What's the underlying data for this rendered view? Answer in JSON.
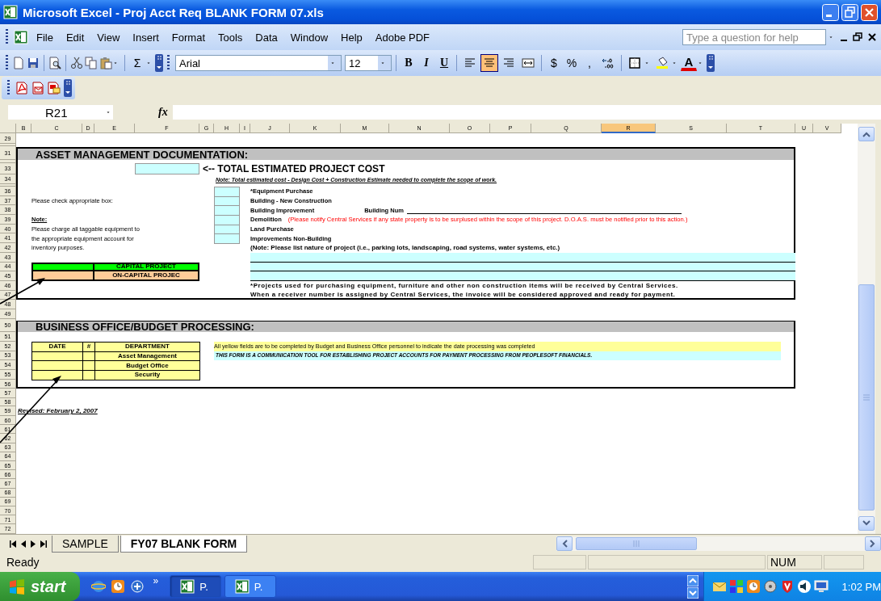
{
  "window": {
    "title": "Microsoft Excel - Proj Acct Req BLANK FORM 07.xls"
  },
  "menu": [
    "File",
    "Edit",
    "View",
    "Insert",
    "Format",
    "Tools",
    "Data",
    "Window",
    "Help",
    "Adobe PDF"
  ],
  "help_box": {
    "placeholder": "Type a question for help"
  },
  "standard_toolbar": [
    {
      "kind": "new"
    },
    {
      "kind": "save"
    },
    {
      "kind": "separator"
    },
    {
      "kind": "preview"
    },
    {
      "kind": "separator"
    },
    {
      "kind": "cut"
    },
    {
      "kind": "copy"
    },
    {
      "kind": "paste"
    },
    {
      "kind": "dropdown"
    },
    {
      "kind": "separator"
    },
    {
      "kind": "text",
      "label": "Σ"
    },
    {
      "kind": "dropdown"
    },
    {
      "kind": "overflow"
    }
  ],
  "formatting_toolbar": {
    "font": "Arial",
    "size": "12",
    "buttons": [
      {
        "kind": "bold",
        "label": "B",
        "on": false
      },
      {
        "kind": "italic",
        "label": "I",
        "on": false
      },
      {
        "kind": "underline",
        "label": "U",
        "on": false
      },
      {
        "kind": "separator"
      },
      {
        "kind": "align-left",
        "on": false
      },
      {
        "kind": "align-center",
        "on": true
      },
      {
        "kind": "align-right",
        "on": false
      },
      {
        "kind": "merge",
        "on": false
      },
      {
        "kind": "separator"
      },
      {
        "kind": "text",
        "label": "$",
        "on": false
      },
      {
        "kind": "text",
        "label": "%",
        "on": false
      },
      {
        "kind": "text",
        "label": ",",
        "on": false
      },
      {
        "kind": "decimal",
        "on": false
      },
      {
        "kind": "separator"
      },
      {
        "kind": "borders",
        "on": false
      },
      {
        "kind": "dropdown"
      },
      {
        "kind": "fill",
        "on": false
      },
      {
        "kind": "dropdown"
      },
      {
        "kind": "font-color",
        "label": "A",
        "on": false
      },
      {
        "kind": "dropdown"
      },
      {
        "kind": "overflow"
      }
    ]
  },
  "pdf_toolbar": [
    {
      "kind": "pdf"
    },
    {
      "kind": "pdf-mail"
    },
    {
      "kind": "pdf-review"
    }
  ],
  "formula_bar": {
    "name_box": "R21",
    "function_label": "fx"
  },
  "columns": [
    {
      "label": "B",
      "selected": false
    },
    {
      "label": "C",
      "selected": false
    },
    {
      "label": "D",
      "selected": false
    },
    {
      "label": "E",
      "selected": false
    },
    {
      "label": "F",
      "selected": false
    },
    {
      "label": "G",
      "selected": false
    },
    {
      "label": "H",
      "selected": false
    },
    {
      "label": "I",
      "selected": false
    },
    {
      "label": "J",
      "selected": false
    },
    {
      "label": "K",
      "selected": false
    },
    {
      "label": "M",
      "selected": false
    },
    {
      "label": "N",
      "selected": false
    },
    {
      "label": "O",
      "selected": false
    },
    {
      "label": "P",
      "selected": false
    },
    {
      "label": "Q",
      "selected": false
    },
    {
      "label": "R",
      "selected": true
    },
    {
      "label": "S",
      "selected": false
    },
    {
      "label": "T",
      "selected": false
    },
    {
      "label": "U",
      "selected": false
    },
    {
      "label": "V",
      "selected": false
    }
  ],
  "rows": [
    {
      "kind": "row",
      "label": "29"
    },
    {
      "kind": "collapsed"
    },
    {
      "kind": "row",
      "label": "31"
    },
    {
      "kind": "collapsed"
    },
    {
      "kind": "row",
      "label": "33"
    },
    {
      "kind": "row",
      "label": "34"
    },
    {
      "kind": "collapsed"
    },
    {
      "kind": "row",
      "label": "36"
    },
    {
      "kind": "row",
      "label": "37"
    },
    {
      "kind": "row",
      "label": "38"
    },
    {
      "kind": "row",
      "label": "39"
    },
    {
      "kind": "row",
      "label": "40"
    },
    {
      "kind": "row",
      "label": "41"
    },
    {
      "kind": "row",
      "label": "42"
    },
    {
      "kind": "row",
      "label": "43"
    },
    {
      "kind": "row",
      "label": "44"
    },
    {
      "kind": "row",
      "label": "45"
    },
    {
      "kind": "row",
      "label": "46"
    },
    {
      "kind": "row",
      "label": "47"
    },
    {
      "kind": "row",
      "label": "48"
    },
    {
      "kind": "row",
      "label": "49"
    },
    {
      "kind": "row",
      "label": "50"
    },
    {
      "kind": "row",
      "label": "51"
    },
    {
      "kind": "row",
      "label": "52"
    },
    {
      "kind": "row",
      "label": "53"
    },
    {
      "kind": "row",
      "label": "54"
    },
    {
      "kind": "row",
      "label": "55"
    },
    {
      "kind": "row",
      "label": "56"
    },
    {
      "kind": "row",
      "label": "57"
    },
    {
      "kind": "row",
      "label": "58"
    },
    {
      "kind": "row",
      "label": "59"
    },
    {
      "kind": "row",
      "label": "60"
    },
    {
      "kind": "row",
      "label": "61"
    },
    {
      "kind": "row",
      "label": "62"
    },
    {
      "kind": "row",
      "label": "63"
    },
    {
      "kind": "row",
      "label": "64"
    },
    {
      "kind": "row",
      "label": "65"
    },
    {
      "kind": "row",
      "label": "66"
    },
    {
      "kind": "row",
      "label": "67"
    },
    {
      "kind": "row",
      "label": "68"
    },
    {
      "kind": "row",
      "label": "69"
    },
    {
      "kind": "row",
      "label": "70"
    },
    {
      "kind": "row",
      "label": "71"
    },
    {
      "kind": "row",
      "label": "72"
    }
  ],
  "asset_section": {
    "title": "ASSET MANAGEMENT DOCUMENTATION:",
    "total_label": "<-- TOTAL ESTIMATED PROJECT COST",
    "total_note": "Note: Total estimated cost - Design Cost + Construction Estimate needed to complete the scope of work.",
    "check_prompt": "Please check appropriate box:",
    "note_heading": "Note:",
    "note_lines": [
      "Please charge all taggable equipment to",
      "the appropriate equipment account for",
      "inventory purposes."
    ],
    "options": [
      {
        "label": "*Equipment Purchase",
        "checked": false
      },
      {
        "label": "Building - New Construction",
        "checked": false
      },
      {
        "label": "Building Improvement",
        "checked": false,
        "extra": {
          "kind": "number-line",
          "text": "Building Num"
        }
      },
      {
        "label": "Demolition",
        "checked": false,
        "extra": {
          "kind": "warning",
          "text": "(Please notify Central Services if any state property is to be surplused within the scope of this project.  D.O.A.S. must be notified prior to this action.)"
        }
      },
      {
        "label": "Land Purchase",
        "checked": false
      },
      {
        "label": "Improvements Non-Building",
        "checked": false
      }
    ],
    "list_note": "(Note:  Please list nature of project (i.e., parking lots, landscaping, road systems, water systems, etc.)",
    "project_types": [
      {
        "label": "CAPITAL PROJECT",
        "color": "#00ff00"
      },
      {
        "label": "ON-CAPITAL PROJEC",
        "color": "#ffcc99"
      }
    ],
    "footnotes": [
      "*Projects used for purchasing equipment, furniture and other non construction items will be received by Central Services.",
      "When a receiver number is assigned by Central Services, the invoice will be considered approved and ready for payment."
    ]
  },
  "business_section": {
    "title": "BUSINESS OFFICE/BUDGET PROCESSING:",
    "columns": [
      "DATE",
      "#",
      "DEPARTMENT"
    ],
    "departments": [
      "Asset Management",
      "Budget Office",
      "Security"
    ],
    "instructions": "All yellow fields are to be completed by Budget and Business Office personnel to indicate the date processing was completed",
    "notice": "THIS FORM IS A COMMUNICATION TOOL FOR ESTABLISHING PROJECT ACCOUNTS FOR PAYMENT PROCESSING FROM PEOPLESOFT FINANCIALS."
  },
  "revised": "Revised: February 2, 2007",
  "sheet_tabs": [
    {
      "label": "SAMPLE",
      "selected": false
    },
    {
      "label": "FY07 BLANK FORM",
      "selected": true
    }
  ],
  "status_bar": {
    "text": "Ready",
    "indicators": [
      "NUM"
    ]
  },
  "taskbar": {
    "start": "start",
    "quick_launch": [
      {
        "kind": "browser"
      },
      {
        "kind": "clock"
      },
      {
        "kind": "app"
      }
    ],
    "more": "»",
    "windows": [
      {
        "label": "P.",
        "selected": true
      },
      {
        "label": "P.",
        "selected": false
      }
    ],
    "tray": [
      {
        "kind": "mail"
      },
      {
        "kind": "grid"
      },
      {
        "kind": "clock"
      },
      {
        "kind": "disc"
      },
      {
        "kind": "shield"
      },
      {
        "kind": "speaker"
      },
      {
        "kind": "monitor"
      }
    ],
    "time": "1:02 PM"
  }
}
